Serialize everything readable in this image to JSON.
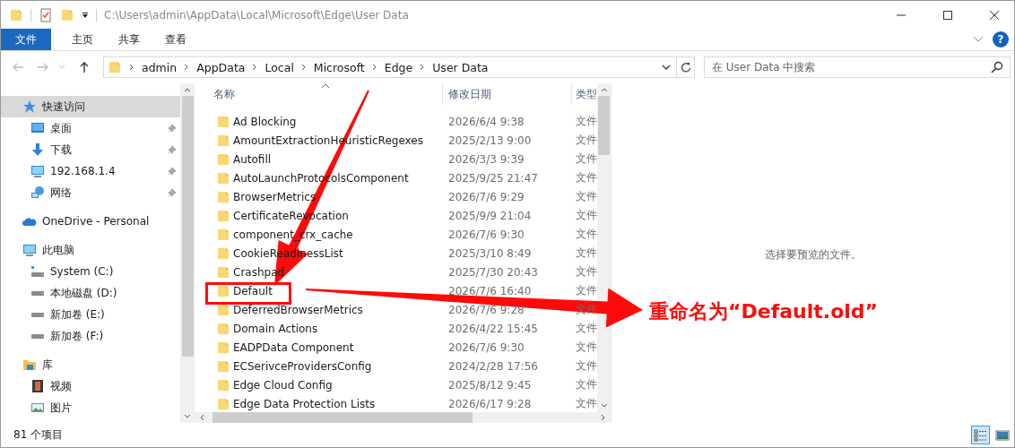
{
  "window": {
    "title": "C:\\Users\\admin\\AppData\\Local\\Microsoft\\Edge\\User Data"
  },
  "ribbon_tabs": [
    {
      "label": "文件",
      "kind": "menu"
    },
    {
      "label": "主页",
      "kind": "tab"
    },
    {
      "label": "共享",
      "kind": "tab"
    },
    {
      "label": "查看",
      "kind": "tab"
    }
  ],
  "help": "?",
  "address": {
    "crumbs": [
      "admin",
      "AppData",
      "Local",
      "Microsoft",
      "Edge",
      "User Data"
    ]
  },
  "search": {
    "placeholder": "在 User Data 中搜索"
  },
  "sidebar": {
    "items": [
      {
        "label": "快速访问",
        "kind": "star",
        "selected": true,
        "children": [
          {
            "label": "桌面",
            "kind": "desktop",
            "pinned": true,
            "selected": false
          },
          {
            "label": "下载",
            "kind": "download",
            "pinned": true,
            "selected": false
          },
          {
            "label": "192.168.1.4",
            "kind": "monitor",
            "pinned": true,
            "selected": false
          },
          {
            "label": "网络",
            "kind": "network",
            "pinned": true,
            "selected": false
          }
        ]
      },
      {
        "label": "OneDrive - Personal",
        "kind": "cloud",
        "selected": false
      },
      {
        "label": "此电脑",
        "kind": "monitor",
        "selected": false,
        "children": [
          {
            "label": "System (C:)",
            "kind": "system-drive",
            "pinned": false,
            "selected": false
          },
          {
            "label": "本地磁盘 (D:)",
            "kind": "drive",
            "pinned": false,
            "selected": false
          },
          {
            "label": "新加卷 (E:)",
            "kind": "drive",
            "pinned": false,
            "selected": false
          },
          {
            "label": "新加卷 (F:)",
            "kind": "drive",
            "pinned": false,
            "selected": false
          }
        ]
      },
      {
        "label": "库",
        "kind": "library",
        "selected": false,
        "children": [
          {
            "label": "视频",
            "kind": "video",
            "pinned": false,
            "selected": false
          },
          {
            "label": "图片",
            "kind": "picture",
            "pinned": false,
            "selected": false
          }
        ]
      }
    ]
  },
  "table": {
    "columns": [
      "名称",
      "修改日期",
      "类型"
    ],
    "rows": [
      {
        "name": "Ad Blocking",
        "modified": "2026/6/4 9:38",
        "type": "文件",
        "boxed": false
      },
      {
        "name": "AmountExtractionHeuristicRegexes",
        "modified": "2025/2/13 9:00",
        "type": "文件",
        "boxed": false
      },
      {
        "name": "Autofill",
        "modified": "2026/3/3 9:39",
        "type": "文件",
        "boxed": false
      },
      {
        "name": "AutoLaunchProtocolsComponent",
        "modified": "2025/9/25 21:47",
        "type": "文件",
        "boxed": false
      },
      {
        "name": "BrowserMetrics",
        "modified": "2026/7/6 9:29",
        "type": "文件",
        "boxed": false
      },
      {
        "name": "CertificateRevocation",
        "modified": "2025/9/9 21:04",
        "type": "文件",
        "boxed": false
      },
      {
        "name": "component_crx_cache",
        "modified": "2026/7/6 9:30",
        "type": "文件",
        "boxed": false
      },
      {
        "name": "CookieReadinessList",
        "modified": "2025/3/10 8:49",
        "type": "文件",
        "boxed": false
      },
      {
        "name": "Crashpad",
        "modified": "2025/7/30 20:43",
        "type": "文件",
        "boxed": false
      },
      {
        "name": "Default",
        "modified": "2026/7/6 16:40",
        "type": "文件",
        "boxed": true
      },
      {
        "name": "DeferredBrowserMetrics",
        "modified": "2026/7/6 9:28",
        "type": "文件",
        "boxed": false
      },
      {
        "name": "Domain Actions",
        "modified": "2026/4/22 15:45",
        "type": "文件",
        "boxed": false
      },
      {
        "name": "EADPData Component",
        "modified": "2026/7/6 9:30",
        "type": "文件",
        "boxed": false
      },
      {
        "name": "ECSerivceProvidersConfig",
        "modified": "2024/2/28 17:56",
        "type": "文件",
        "boxed": false
      },
      {
        "name": "Edge Cloud Config",
        "modified": "2025/8/12 9:45",
        "type": "文件",
        "boxed": false
      },
      {
        "name": "Edge Data Protection Lists",
        "modified": "2026/6/17 9:28",
        "type": "文件",
        "boxed": false
      }
    ]
  },
  "preview": {
    "message": "选择要预览的文件。"
  },
  "annotation": {
    "text": "重命名为“Default.old”"
  },
  "status_bar": {
    "count": "81 个项目",
    "views": [
      {
        "kind": "details",
        "selected": true
      },
      {
        "kind": "thumbnails",
        "selected": false
      }
    ]
  }
}
